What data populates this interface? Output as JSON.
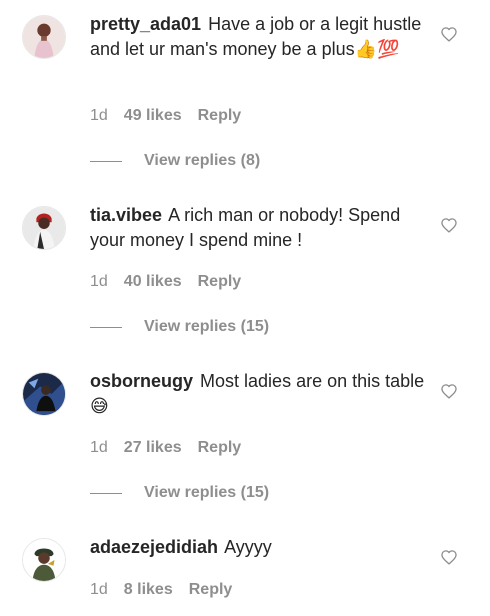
{
  "comments": [
    {
      "username": "pretty_ada01",
      "text": "Have a job or a legit hustle and let ur man's money be a plus👍💯",
      "time": "1d",
      "likes": "49 likes",
      "reply": "Reply",
      "view_replies": "View replies (8)"
    },
    {
      "username": "tia.vibee",
      "text": "A rich man or nobody! Spend your money I spend mine !",
      "time": "1d",
      "likes": "40 likes",
      "reply": "Reply",
      "view_replies": "View replies (15)"
    },
    {
      "username": "osborneugy",
      "text": "Most ladies are on this table😅",
      "time": "1d",
      "likes": "27 likes",
      "reply": "Reply",
      "view_replies": "View replies (15)"
    },
    {
      "username": "adaezejedidiah",
      "text": "Ayyyy",
      "time": "1d",
      "likes": "8 likes",
      "reply": "Reply"
    }
  ],
  "icons": {
    "like": "heart-outline-icon",
    "avatar": "user-avatar"
  }
}
